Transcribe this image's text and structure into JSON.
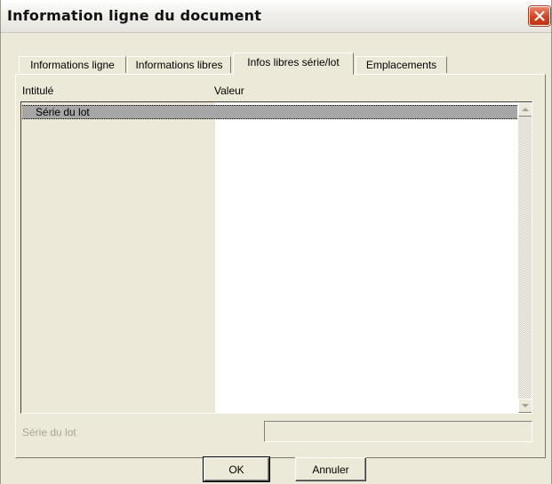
{
  "window": {
    "title": "Information ligne du document"
  },
  "tabs": [
    {
      "label": "Informations ligne",
      "active": false
    },
    {
      "label": "Informations libres",
      "active": false
    },
    {
      "label": "Infos libres série/lot",
      "active": true
    },
    {
      "label": "Emplacements",
      "active": false
    }
  ],
  "grid": {
    "columns": [
      "Intitulé",
      "Valeur"
    ],
    "rows": [
      {
        "label": "Série du lot",
        "value": ""
      }
    ]
  },
  "field": {
    "label": "Série du lot",
    "value": ""
  },
  "buttons": {
    "ok": "OK",
    "cancel": "Annuler"
  },
  "colors": {
    "dialog_bg": "#ece9d8",
    "close_button": "#d5421f",
    "selected_row": "#a6a6a6"
  },
  "icons": {
    "close": "close-icon",
    "scroll_up": "arrow-up-icon",
    "scroll_down": "arrow-down-icon"
  }
}
